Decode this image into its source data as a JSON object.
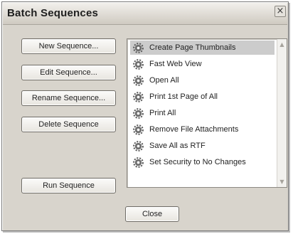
{
  "dialog": {
    "title": "Batch Sequences",
    "close_glyph": "×",
    "buttons": {
      "new": "New Sequence...",
      "edit": "Edit Sequence...",
      "rename": "Rename Sequence...",
      "delete": "Delete Sequence",
      "run": "Run Sequence",
      "close": "Close"
    }
  },
  "sequences": {
    "selected_index": 0,
    "item_icon": "gear-icon",
    "items": [
      "Create Page Thumbnails",
      "Fast Web View",
      "Open All",
      "Print 1st Page of All",
      "Print All",
      "Remove File Attachments",
      "Save All as RTF",
      "Set Security to No Changes"
    ]
  },
  "scrollbar": {
    "up_glyph": "▲",
    "down_glyph": "▼"
  }
}
